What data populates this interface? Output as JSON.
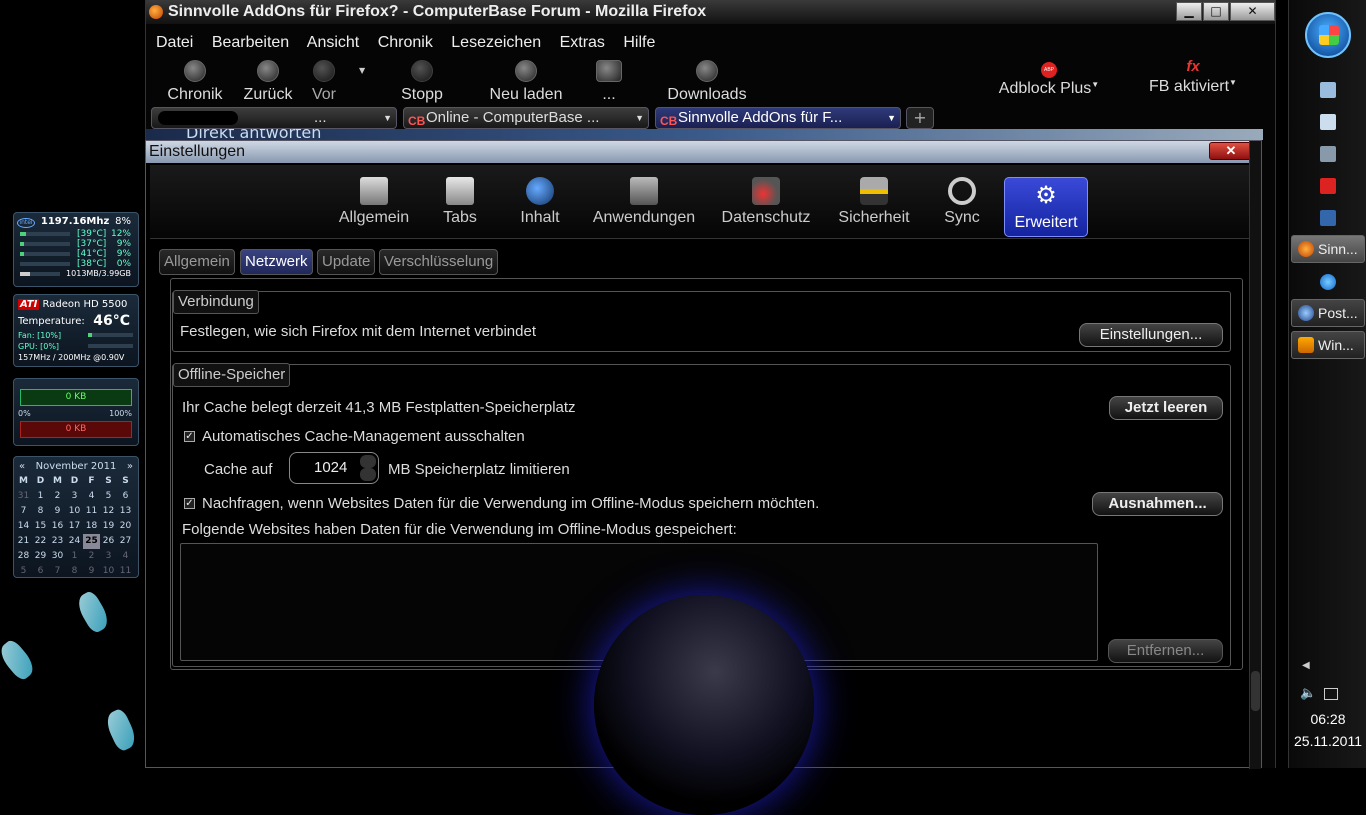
{
  "window": {
    "title": "Sinnvolle AddOns für Firefox? - ComputerBase Forum - Mozilla Firefox"
  },
  "menu": [
    "Datei",
    "Bearbeiten",
    "Ansicht",
    "Chronik",
    "Lesezeichen",
    "Extras",
    "Hilfe"
  ],
  "toolbar": {
    "history": "Chronik",
    "back": "Zurück",
    "forward": "Vor",
    "stop": "Stopp",
    "reload": "Neu laden",
    "more": "...",
    "downloads": "Downloads",
    "adblock": "Adblock Plus",
    "fb": "FB aktiviert"
  },
  "tabs": {
    "tab1": "...",
    "tab2": "Online - ComputerBase ...",
    "tab3": "Sinnvolle AddOns für F...",
    "peek": "Direkt antworten"
  },
  "dialog": {
    "title": "Einstellungen",
    "panes": [
      "Allgemein",
      "Tabs",
      "Inhalt",
      "Anwendungen",
      "Datenschutz",
      "Sicherheit",
      "Sync",
      "Erweitert"
    ],
    "subtabs": [
      "Allgemein",
      "Netzwerk",
      "Update",
      "Verschlüsselung"
    ],
    "connection": {
      "legend": "Verbindung",
      "desc": "Festlegen, wie sich Firefox mit dem Internet verbindet",
      "button": "Einstellungen..."
    },
    "offline": {
      "legend": "Offline-Speicher",
      "cache_text": "Ihr Cache belegt derzeit 41,3 MB Festplatten-Speicherplatz",
      "clear_button": "Jetzt leeren",
      "override_label": "Automatisches Cache-Management ausschalten",
      "cache_prefix": "Cache auf",
      "cache_value": "1024",
      "cache_suffix": "MB Speicherplatz limitieren",
      "ask_label": "Nachfragen, wenn Websites Daten für die Verwendung im Offline-Modus speichern möchten.",
      "exceptions_button": "Ausnahmen...",
      "list_label": "Folgende Websites haben Daten für die Verwendung im Offline-Modus gespeichert:",
      "remove_button": "Entfernen..."
    }
  },
  "gadgets": {
    "cpu_freq": "1197.16Mhz",
    "cpu_pct": "8%",
    "cores": [
      {
        "temp": "[39°C]",
        "pct": "12%"
      },
      {
        "temp": "[37°C]",
        "pct": "9%"
      },
      {
        "temp": "[41°C]",
        "pct": "9%"
      },
      {
        "temp": "[38°C]",
        "pct": "0%"
      }
    ],
    "mem": "1013MB/3.99GB",
    "gpu_name": "Radeon HD 5500",
    "gpu_temp_label": "Temperature:",
    "gpu_temp": "46°C",
    "fan": "Fan: [10%]",
    "gpu_load": "GPU: [0%]",
    "clocks": "157MHz / 200MHz @0.90V",
    "net_up": "0 KB",
    "net_down": "0 KB",
    "net_min": "0%",
    "net_max": "100%",
    "calendar_month": "November 2011",
    "weekdays": [
      "M",
      "D",
      "M",
      "D",
      "F",
      "S",
      "S"
    ],
    "days": [
      "31",
      "1",
      "2",
      "3",
      "4",
      "5",
      "6",
      "7",
      "8",
      "9",
      "10",
      "11",
      "12",
      "13",
      "14",
      "15",
      "16",
      "17",
      "18",
      "19",
      "20",
      "21",
      "22",
      "23",
      "24",
      "25",
      "26",
      "27",
      "28",
      "29",
      "30",
      "1",
      "2",
      "3",
      "4",
      "5",
      "6",
      "7",
      "8",
      "9",
      "10",
      "11"
    ]
  },
  "taskbar": {
    "tasks": [
      "Sinn...",
      "Post...",
      "Win..."
    ],
    "time": "06:28",
    "date": "25.11.2011"
  }
}
